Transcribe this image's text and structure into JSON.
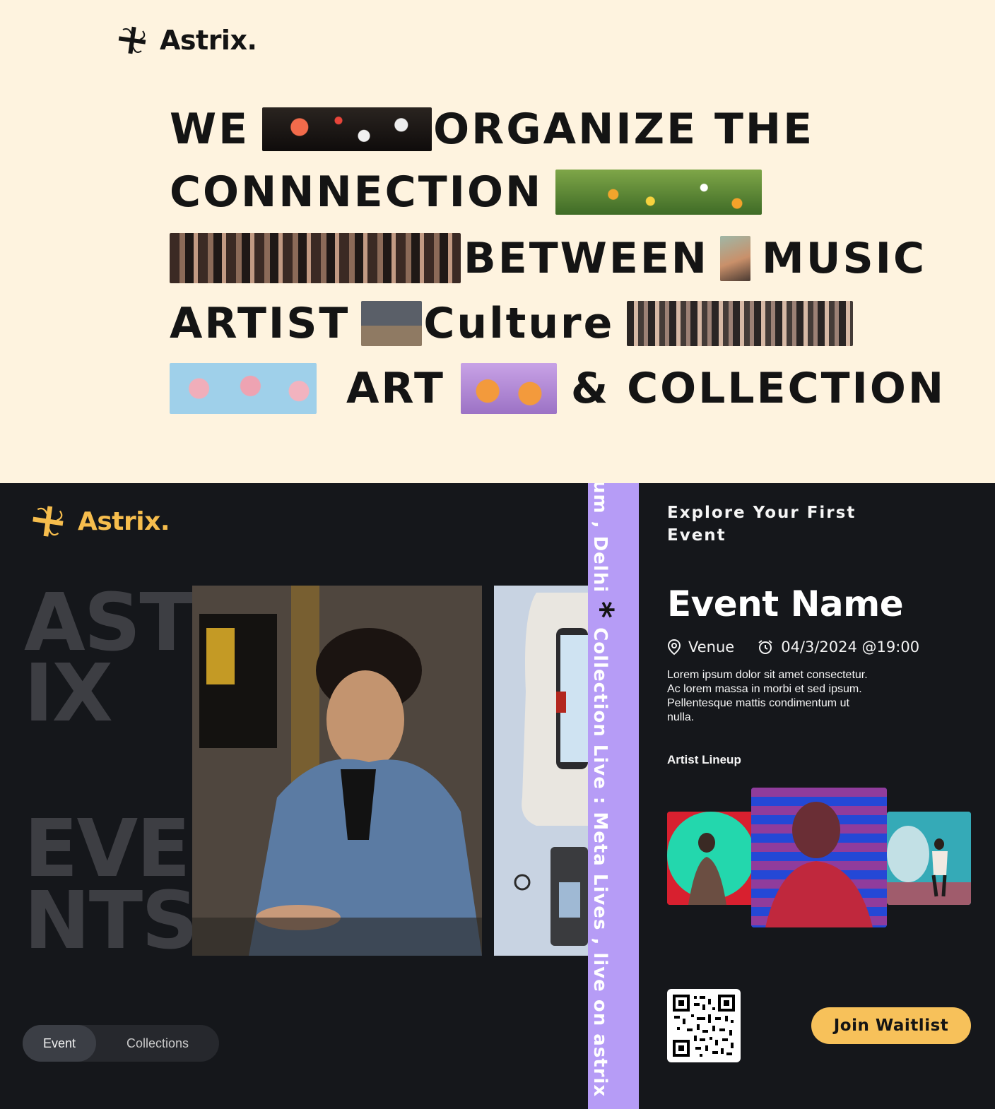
{
  "brand": {
    "name": "Astrix."
  },
  "hero": {
    "w1": "WE",
    "w2": "ORGANIZE THE",
    "w3": "CONNNECTION",
    "w4": "BETWEEN",
    "w5": "MUSIC",
    "w6": "ARTIST",
    "w7": "Culture",
    "w8": "ART",
    "w9": "& COLLECTION"
  },
  "background_words": {
    "a": "AST",
    "b": "IX",
    "c": "EVE",
    "d": "NTS"
  },
  "tabs": [
    {
      "label": "Event"
    },
    {
      "label": "Collections"
    }
  ],
  "strip": {
    "text_before": "um , Delhi",
    "star": "*",
    "text_after": "Collection Live : Meta Lives , live on astrix"
  },
  "event": {
    "heading": "Explore Your First Event",
    "name": "Event Name",
    "venue": "Venue",
    "datetime": "04/3/2024 @19:00",
    "description": "Lorem ipsum dolor sit amet consectetur. Ac lorem massa in morbi et sed ipsum. Pellentesque mattis condimentum ut nulla.",
    "lineup_title": "Artist Lineup",
    "cta": "Join Waitlist"
  },
  "colors": {
    "cream": "#fef3df",
    "dark": "#15171b",
    "accent_yellow": "#f7c15a",
    "strip_purple": "#b69cf6"
  },
  "icons": [
    "pinwheel-logo-icon",
    "location-pin-icon",
    "alarm-clock-icon",
    "asterisk-icon",
    "qr-code-icon"
  ]
}
